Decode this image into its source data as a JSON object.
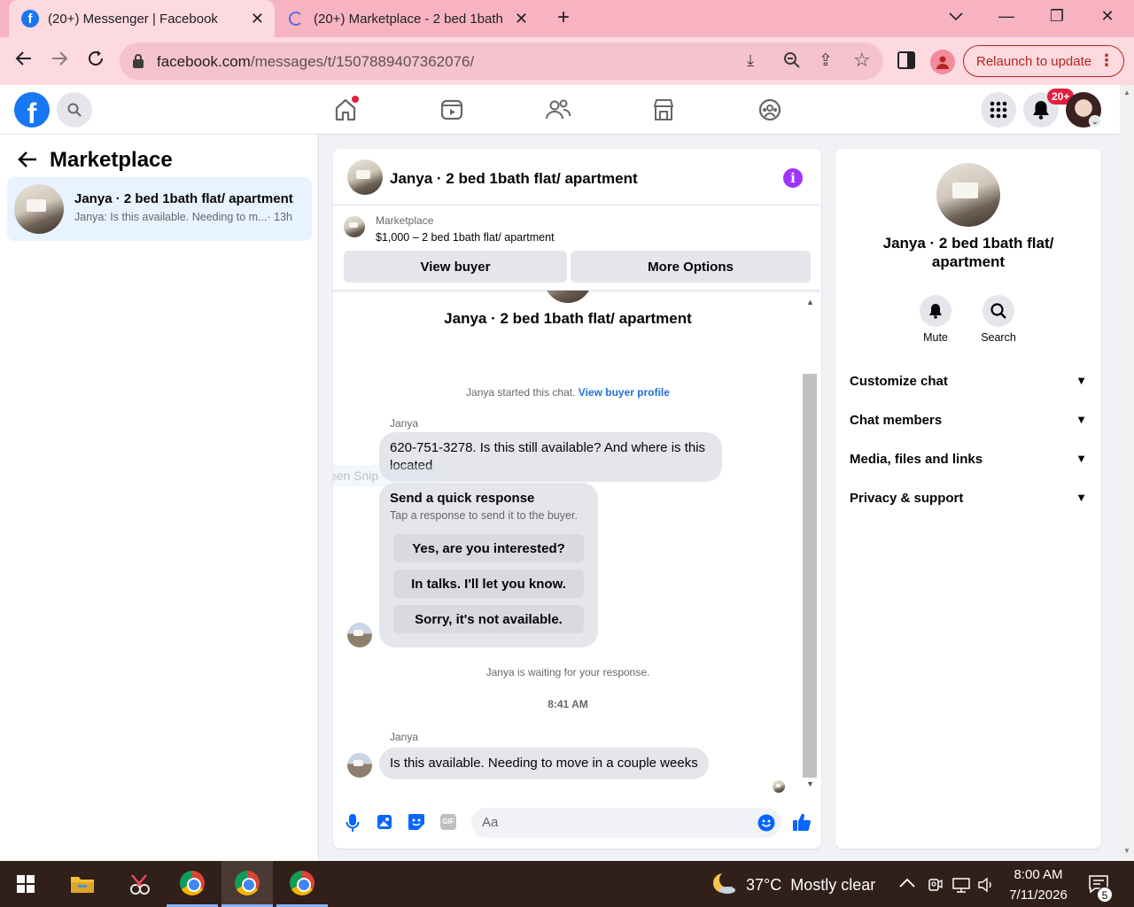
{
  "browser": {
    "tabs": [
      {
        "title": "(20+) Messenger | Facebook",
        "active": true
      },
      {
        "title": "(20+) Marketplace - 2 bed 1bath",
        "active": false
      }
    ],
    "url_host": "facebook.com",
    "url_path": "/messages/t/1507889407362076/",
    "relaunch_label": "Relaunch to update"
  },
  "fb_header": {
    "notification_badge": "20+"
  },
  "left_panel": {
    "title": "Marketplace",
    "conversation": {
      "title": "Janya · 2 bed 1bath flat/ apartment",
      "preview": "Janya: Is this available. Needing to m...",
      "time": "· 13h"
    }
  },
  "chat": {
    "title": "Janya · 2 bed 1bath flat/ apartment",
    "marketplace_label": "Marketplace",
    "listing": "$1,000 – 2 bed 1bath flat/ apartment",
    "view_buyer": "View buyer",
    "more_options": "More Options",
    "header_name": "Janya · 2 bed 1bath flat/ apartment",
    "started_text": "Janya started this chat.",
    "view_buyer_profile": "View buyer profile",
    "sender1": "Janya",
    "message1": "620-751-3278. Is this still available? And where is this located",
    "overlay_text": "Full-screen Snip",
    "quick_title": "Send a quick response",
    "quick_sub": "Tap a response to send it to the buyer.",
    "quick_replies": [
      "Yes, are you interested?",
      "In talks. I'll let you know.",
      "Sorry, it's not available."
    ],
    "waiting_text": "Janya is waiting for your response.",
    "timestamp": "8:41 AM",
    "sender2": "Janya",
    "message2": "Is this available. Needing to move in a couple weeks",
    "composer_placeholder": "Aa"
  },
  "right_panel": {
    "name": "Janya · 2 bed 1bath flat/ apartment",
    "mute_label": "Mute",
    "search_label": "Search",
    "sections": [
      "Customize chat",
      "Chat members",
      "Media, files and links",
      "Privacy & support"
    ]
  },
  "taskbar": {
    "weather": "37°C  Mostly clear",
    "time": "8:00 AM",
    "date": "7/11/2026",
    "notif_count": "5"
  }
}
